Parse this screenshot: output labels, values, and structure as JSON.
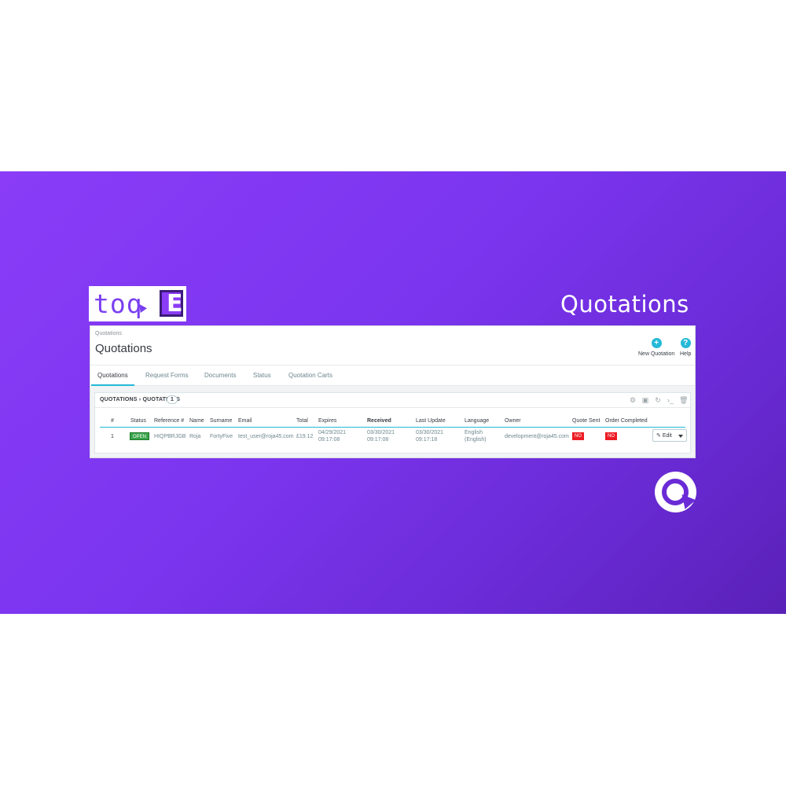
{
  "logo": {
    "text": "toq",
    "letter": "E"
  },
  "banner": {
    "title": "Quotations"
  },
  "panel": {
    "breadcrumb": "Quotations",
    "title": "Quotations",
    "toolbar": [
      {
        "icon": "plus-circle-icon",
        "label": "New Quotation"
      },
      {
        "icon": "help-circle-icon",
        "label": "Help"
      }
    ],
    "tabs": [
      "Quotations",
      "Request Forms",
      "Documents",
      "Status",
      "Quotation Carts"
    ],
    "active_tab": "Quotations",
    "list": {
      "title": "QUOTATIONS › QUOTATIONS",
      "count": "1",
      "tool_icons": [
        "settings-icon",
        "export-icon",
        "refresh-icon",
        "sql-icon",
        "trash-icon"
      ],
      "columns": [
        "#",
        "Status",
        "Reference #",
        "Name",
        "Surname",
        "Email",
        "Total",
        "Expires",
        "Received",
        "Last Update",
        "Language",
        "Owner",
        "Quote Sent",
        "Order Completed"
      ],
      "sorted_column": "Received",
      "rows": [
        {
          "id": "1",
          "status": "OPEN",
          "reference": "HIQPBRJGB",
          "name": "Roja",
          "surname": "FortyFive",
          "email": "test_user@roja45.com",
          "total": "£19.12",
          "expires_date": "04/29/2021",
          "expires_time": "09:17:08",
          "received_date": "03/30/2021",
          "received_time": "09:17:08",
          "updated_date": "03/30/2021",
          "updated_time": "09:17:18",
          "language": "English",
          "language_sub": "(English)",
          "owner": "development@roja45.com",
          "quote_sent": "NO",
          "order_completed": "NO",
          "action": "Edit"
        }
      ]
    }
  },
  "colors": {
    "banner_start": "#8a3cf7",
    "banner_end": "#5a21b8",
    "accent": "#25b9d7",
    "open_badge": "#3aa44b",
    "no_badge": "#ed1c24"
  }
}
